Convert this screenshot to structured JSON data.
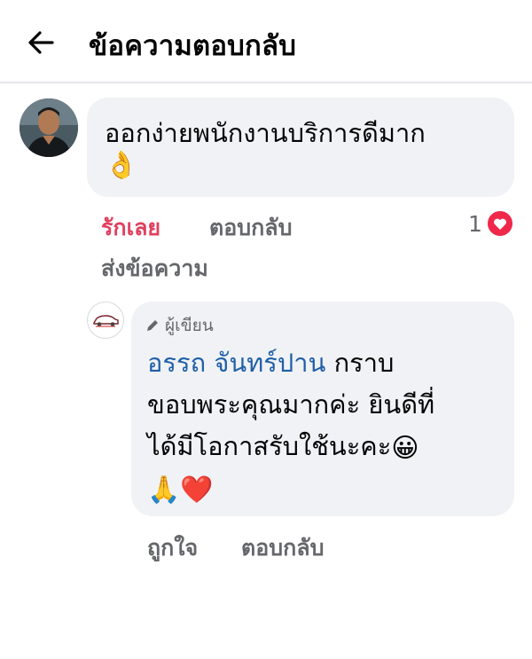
{
  "header": {
    "title": "ข้อความตอบกลับ"
  },
  "comment": {
    "text": "ออกง่ายพนักงานบริการดีมาก",
    "emoji": "👌",
    "actions": {
      "love": "รักเลย",
      "reply": "ตอบกลับ",
      "send_message": "ส่งข้อความ"
    },
    "reaction_count": "1",
    "colors": {
      "love": "#e0405e",
      "heart": "#f0284a"
    }
  },
  "reply": {
    "author_badge": "ผู้เขียน",
    "mention": "อรรถ จันทร์ปาน",
    "line1_rest": " กราบ",
    "line2": "ขอบพระคุณมากค่ะ ยินดีที่",
    "line3": "ได้มีโอกาสรับใช้นะคะ",
    "emoji_smile": "😀",
    "emoji_pray": "🙏",
    "emoji_heart": "❤️",
    "actions": {
      "like": "ถูกใจ",
      "reply": "ตอบกลับ"
    },
    "colors": {
      "mention": "#1f5fa8"
    }
  }
}
